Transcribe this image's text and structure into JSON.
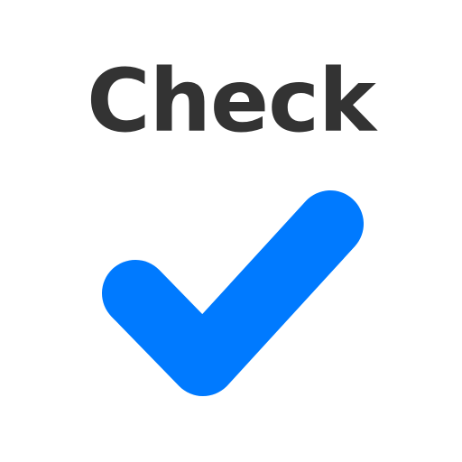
{
  "title": {
    "text": "Check",
    "color": "#333333"
  },
  "icon": {
    "name": "checkmark",
    "color": "#007AFF"
  }
}
